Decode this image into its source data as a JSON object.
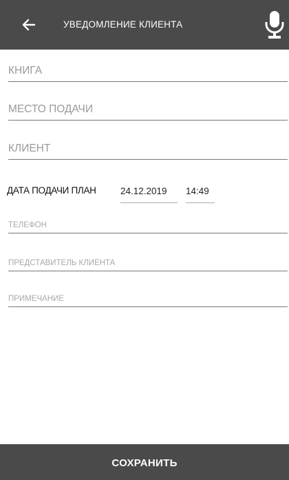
{
  "header": {
    "title": "УВЕДОМЛЕНИЕ КЛИЕНТА",
    "back_icon": "arrow-left-icon",
    "mic_icon": "microphone-icon",
    "background": "#4a4a4a"
  },
  "form": {
    "book_label": "КНИГА",
    "place_label": "МЕСТО ПОДАЧИ",
    "client_label": "КЛИЕНТ",
    "date_plan_label": "ДАТА ПОДАЧИ ПЛАН",
    "date_value": "24.12.2019",
    "time_value": "14:49",
    "phone_label": "ТЕЛЕФОН",
    "representative_label": "ПРЕДСТАВИТЕЛЬ КЛИЕНТА",
    "note_label": "ПРИМЕЧАНИЕ"
  },
  "footer": {
    "save_label": "СОХРАНИТЬ"
  }
}
